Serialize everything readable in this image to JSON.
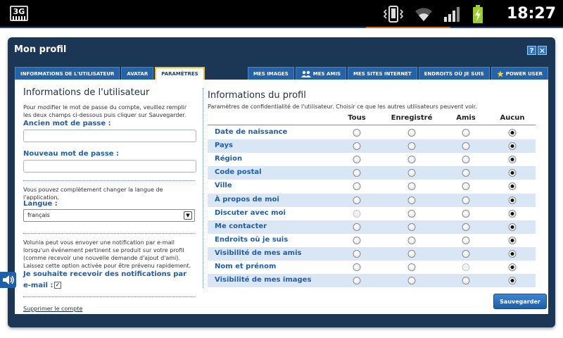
{
  "statusbar": {
    "network_label": "3G",
    "clock": "18:27",
    "icons": [
      "3g-icon",
      "vibrate-icon",
      "wifi-icon",
      "signal-icon",
      "battery-charging-icon"
    ]
  },
  "dialog": {
    "title": "Mon profil",
    "help_label": "?",
    "close_label": "✕"
  },
  "tabs_left": [
    {
      "label": "INFORMATIONS DE L'UTILISATEUR",
      "active": false
    },
    {
      "label": "AVATAR",
      "active": false
    },
    {
      "label": "PARAMÈTRES",
      "active": true
    }
  ],
  "tabs_right": [
    {
      "label": "MES IMAGES",
      "icon": ""
    },
    {
      "label": "MES AMIS",
      "icon": "friends-icon"
    },
    {
      "label": "MES SITES INTERNET",
      "icon": ""
    },
    {
      "label": "ENDROITS OÙ JE SUIS",
      "icon": ""
    },
    {
      "label": "POWER USER",
      "icon": "star-icon"
    }
  ],
  "user_info": {
    "title": "Informations de l'utilisateur",
    "password_help": "Pour modifier le mot de passe du compte, veuillez remplir les deux champs ci-dessous puis cliquer sur Sauvegarder.",
    "old_password_label": "Ancien mot de passe :",
    "old_password_value": "",
    "new_password_label": "Nouveau mot de passe :",
    "new_password_value": "",
    "language_help": "Vous pouvez complètement changer la langue de l'application.",
    "language_label": "Langue :",
    "language_value": "français",
    "notification_help": "Volunia peut vous envoyer une notification par e-mail lorsqu'un événement pertinent se produit sur votre profil (comme recevoir une nouvelle demande d'ajout d'ami). Laissez cette option activée pour être prévenu rapidement.",
    "notification_label_1": "Je souhaite recevoir des notifications par",
    "notification_label_2": "e-mail :",
    "notification_checked": true,
    "delete_account": "Supprimer le compte"
  },
  "profile_info": {
    "title": "Informations du profil",
    "subtitle": "Paramètres de confidentialité de l'utilisateur. Choisir ce que les autres utilisateurs peuvent voir.",
    "columns": [
      "Tous",
      "Enregistré",
      "Amis",
      "Aucun"
    ],
    "rows": [
      {
        "label": "Date de naissance",
        "selected": 3,
        "disabled": []
      },
      {
        "label": "Pays",
        "selected": 3,
        "disabled": []
      },
      {
        "label": "Région",
        "selected": 3,
        "disabled": []
      },
      {
        "label": "Code postal",
        "selected": 3,
        "disabled": []
      },
      {
        "label": "Ville",
        "selected": 3,
        "disabled": []
      },
      {
        "label": "À propos de moi",
        "selected": 3,
        "disabled": []
      },
      {
        "label": "Discuter avec moi",
        "selected": 3,
        "disabled": [
          0
        ]
      },
      {
        "label": "Me contacter",
        "selected": 3,
        "disabled": []
      },
      {
        "label": "Endroits où je suis",
        "selected": 3,
        "disabled": []
      },
      {
        "label": "Visibilité de mes amis",
        "selected": 3,
        "disabled": []
      },
      {
        "label": "Nom et prénom",
        "selected": 3,
        "disabled": [
          2
        ]
      },
      {
        "label": "Visibilité de mes images",
        "selected": 3,
        "disabled": []
      }
    ],
    "save_label": "Sauvegarder"
  },
  "side_tab": {
    "icon": "speaker-icon"
  }
}
